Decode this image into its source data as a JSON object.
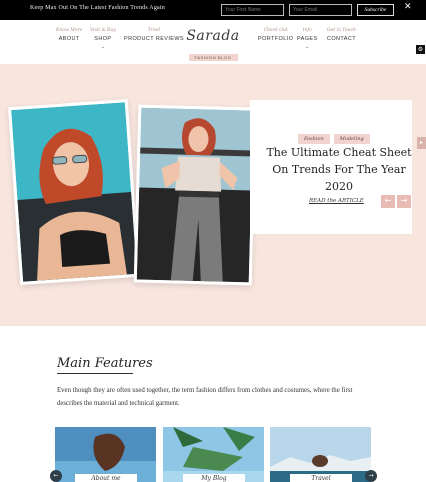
{
  "topbar": {
    "message": "Keep Max Out On The Latest Fashion Trends Again",
    "name_placeholder": "Your First Name",
    "email_placeholder": "Your Email",
    "subscribe_label": "Subscribe",
    "close_glyph": "✕"
  },
  "nav": {
    "items": [
      {
        "script": "Know More",
        "label": "ABOUT",
        "has_dropdown": false
      },
      {
        "script": "Visit & Buy",
        "label": "SHOP",
        "has_dropdown": true
      },
      {
        "script": "Tried",
        "label": "PRODUCT REVIEWS",
        "has_dropdown": false
      },
      {
        "script": "Check Out",
        "label": "PORTFOLIO",
        "has_dropdown": false
      },
      {
        "script": "Info",
        "label": "PAGES",
        "has_dropdown": true
      },
      {
        "script": "Get in Touch",
        "label": "CONTACT",
        "has_dropdown": false
      }
    ],
    "chevron": "⌄",
    "logo_text": "Sarada",
    "logo_tagline": "FASHION BLOG"
  },
  "hero": {
    "tags": [
      "Fashion",
      "Modeling"
    ],
    "title": "The Ultimate Cheat Sheet On Trends For The Year 2020",
    "read_more": "READ the ARTICLE",
    "prev_glyph": "←",
    "next_glyph": "→"
  },
  "features": {
    "title": "Main Features",
    "text": "Even though they are often used together, the term fashion differs from clothes and costumes, where the first describes the material and technical garment.",
    "cards": [
      {
        "caption": "About me"
      },
      {
        "caption": "My Blog"
      },
      {
        "caption": "Travel"
      }
    ]
  },
  "colors": {
    "accent_pink": "#f2d4cf",
    "hero_bg": "#f7e5de",
    "arrow_bg": "#e7bcb4"
  }
}
